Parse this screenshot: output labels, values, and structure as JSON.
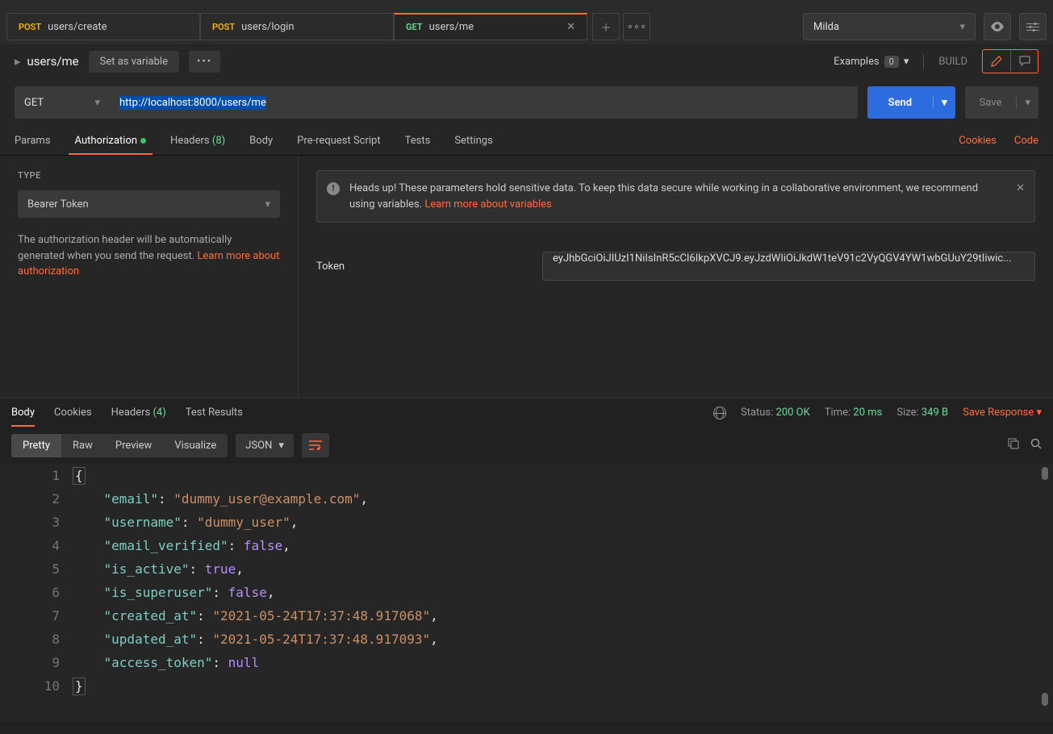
{
  "tabs": [
    {
      "method": "POST",
      "title": "users/create"
    },
    {
      "method": "POST",
      "title": "users/login"
    },
    {
      "method": "GET",
      "title": "users/me"
    }
  ],
  "workspace": {
    "name": "Milda"
  },
  "request": {
    "title": "users/me",
    "set_variable_label": "Set as variable",
    "examples_label": "Examples",
    "examples_count": "0",
    "build_label": "BUILD"
  },
  "url_row": {
    "method": "GET",
    "url": "http://localhost:8000/users/me",
    "send_label": "Send",
    "save_label": "Save"
  },
  "req_subtabs": {
    "params": "Params",
    "authorization": "Authorization",
    "headers": "Headers",
    "headers_count": "(8)",
    "body": "Body",
    "prerequest": "Pre-request Script",
    "tests": "Tests",
    "settings": "Settings",
    "cookies": "Cookies",
    "code": "Code"
  },
  "auth": {
    "type_label": "TYPE",
    "type_value": "Bearer Token",
    "help_text_1": "The authorization header will be automatically generated when you send the request. ",
    "help_link": "Learn more about authorization",
    "banner_text": "Heads up! These parameters hold sensitive data. To keep this data secure while working in a collaborative environment, we recommend using variables. ",
    "banner_link": "Learn more about variables",
    "token_label": "Token",
    "token_value": "eyJhbGciOiJIUzI1NiIsInR5cCI6IkpXVCJ9.eyJzdWIiOiJkdW1teV91c2VyQGV4YW1wbGUuY29tIiwic..."
  },
  "response": {
    "tabs": {
      "body": "Body",
      "cookies": "Cookies",
      "headers": "Headers",
      "headers_count": "(4)",
      "test_results": "Test Results"
    },
    "status_label": "Status:",
    "status_value": "200 OK",
    "time_label": "Time:",
    "time_value": "20 ms",
    "size_label": "Size:",
    "size_value": "349 B",
    "save_response": "Save Response"
  },
  "body_toolbar": {
    "pretty": "Pretty",
    "raw": "Raw",
    "preview": "Preview",
    "visualize": "Visualize",
    "format": "JSON"
  },
  "json_body": [
    {
      "type": "brace_open"
    },
    {
      "key": "email",
      "val": "\"dummy_user@example.com\"",
      "cls": "tok-str",
      "comma": true
    },
    {
      "key": "username",
      "val": "\"dummy_user\"",
      "cls": "tok-str",
      "comma": true
    },
    {
      "key": "email_verified",
      "val": "false",
      "cls": "tok-bool",
      "comma": true
    },
    {
      "key": "is_active",
      "val": "true",
      "cls": "tok-bool",
      "comma": true
    },
    {
      "key": "is_superuser",
      "val": "false",
      "cls": "tok-bool",
      "comma": true
    },
    {
      "key": "created_at",
      "val": "\"2021-05-24T17:37:48.917068\"",
      "cls": "tok-str",
      "comma": true
    },
    {
      "key": "updated_at",
      "val": "\"2021-05-24T17:37:48.917093\"",
      "cls": "tok-str",
      "comma": true
    },
    {
      "key": "access_token",
      "val": "null",
      "cls": "tok-null",
      "comma": false
    },
    {
      "type": "brace_close"
    }
  ]
}
